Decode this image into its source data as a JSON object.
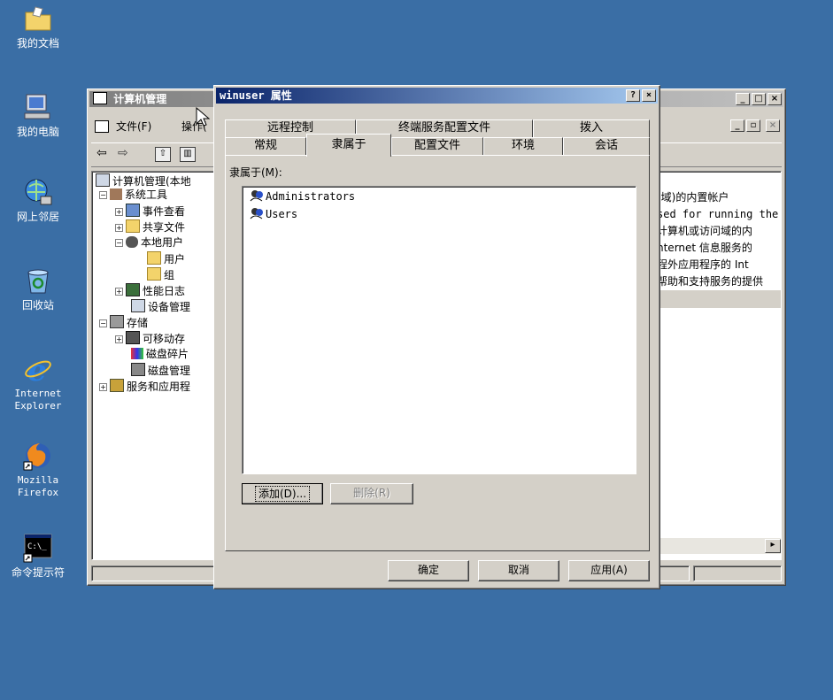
{
  "desktop": {
    "icons": [
      {
        "label": "我的文档"
      },
      {
        "label": "我的电脑"
      },
      {
        "label": "网上邻居"
      },
      {
        "label": "回收站"
      },
      {
        "label": "Internet Explorer",
        "line1": "Internet",
        "line2": "Explorer"
      },
      {
        "label": "Mozilla Firefox",
        "line1": "Mozilla",
        "line2": "Firefox"
      },
      {
        "label": "命令提示符"
      }
    ]
  },
  "mgmt": {
    "title": "计算机管理",
    "menu": [
      "文件(F)",
      "操作("
    ],
    "tree": [
      {
        "label": "计算机管理(本地"
      },
      {
        "label": "系统工具"
      },
      {
        "label": "事件查看"
      },
      {
        "label": "共享文件"
      },
      {
        "label": "本地用户"
      },
      {
        "label": "用户"
      },
      {
        "label": "组"
      },
      {
        "label": "性能日志"
      },
      {
        "label": "设备管理"
      },
      {
        "label": "存储"
      },
      {
        "label": "可移动存"
      },
      {
        "label": "磁盘碎片"
      },
      {
        "label": "磁盘管理"
      },
      {
        "label": "服务和应用程"
      }
    ],
    "desc_lines": [
      "(域)的内置帐户",
      "sed for running the",
      "计算机或访问域的内",
      "nternet 信息服务的",
      "程外应用程序的 Int",
      "帮助和支持服务的提供"
    ]
  },
  "dialog": {
    "title": "winuser 属性",
    "help_btn": "?",
    "close_btn": "×",
    "tabs_row1": [
      "远程控制",
      "终端服务配置文件",
      "拨入"
    ],
    "tabs_row2": [
      "常规",
      "隶属于",
      "配置文件",
      "环境",
      "会话"
    ],
    "member_label": "隶属于(M):",
    "members": [
      "Administrators",
      "Users"
    ],
    "add_btn": "添加(D)...",
    "remove_btn": "删除(R)",
    "ok_btn": "确定",
    "cancel_btn": "取消",
    "apply_btn": "应用(A)"
  },
  "colors": {
    "desktop": "#3a6ea5",
    "face": "#d4d0c8",
    "active_title": "#0a246a",
    "inactive_title": "#808080"
  }
}
